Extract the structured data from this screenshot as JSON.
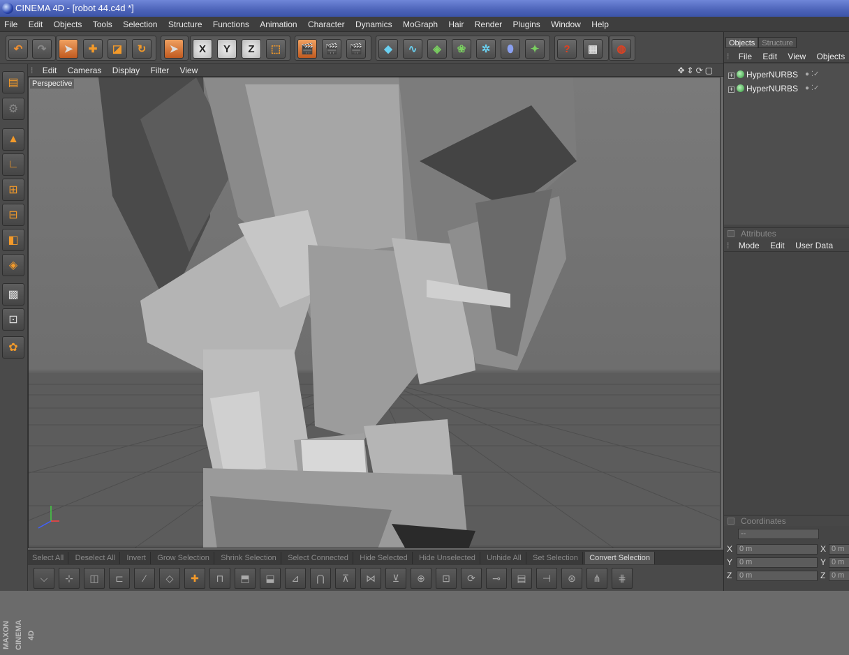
{
  "window": {
    "title": "CINEMA 4D - [robot 44.c4d *]"
  },
  "menubar": [
    "File",
    "Edit",
    "Objects",
    "Tools",
    "Selection",
    "Structure",
    "Functions",
    "Animation",
    "Character",
    "Dynamics",
    "MoGraph",
    "Hair",
    "Render",
    "Plugins",
    "Window",
    "Help"
  ],
  "toolbar": {
    "undo": "↶",
    "redo": "↷",
    "live_select": "X",
    "axis_x": "X",
    "axis_y": "Y",
    "axis_z": "Z"
  },
  "viewport": {
    "menu": [
      "Edit",
      "Cameras",
      "Display",
      "Filter",
      "View"
    ],
    "label": "Perspective",
    "nav_icons": "✥⇕⟳▢"
  },
  "command_bar": [
    "Select All",
    "Deselect All",
    "Invert",
    "Grow Selection",
    "Shrink Selection",
    "Select Connected",
    "Hide Selected",
    "Hide Unselected",
    "Unhide All",
    "Set Selection",
    "Convert Selection"
  ],
  "brand": "MAXON CINEMA 4D",
  "panel": {
    "tabs": [
      "Objects",
      "Structure"
    ],
    "menu": [
      "File",
      "Edit",
      "View",
      "Objects"
    ],
    "objects": [
      "HyperNURBS",
      "HyperNURBS"
    ],
    "attributes_title": "Attributes",
    "attributes_menu": [
      "Mode",
      "Edit",
      "User Data"
    ],
    "coordinates_title": "Coordinates",
    "coord_axes": [
      "X",
      "Y",
      "Z"
    ],
    "coord_value": "0 m",
    "coord_dash": "--"
  }
}
